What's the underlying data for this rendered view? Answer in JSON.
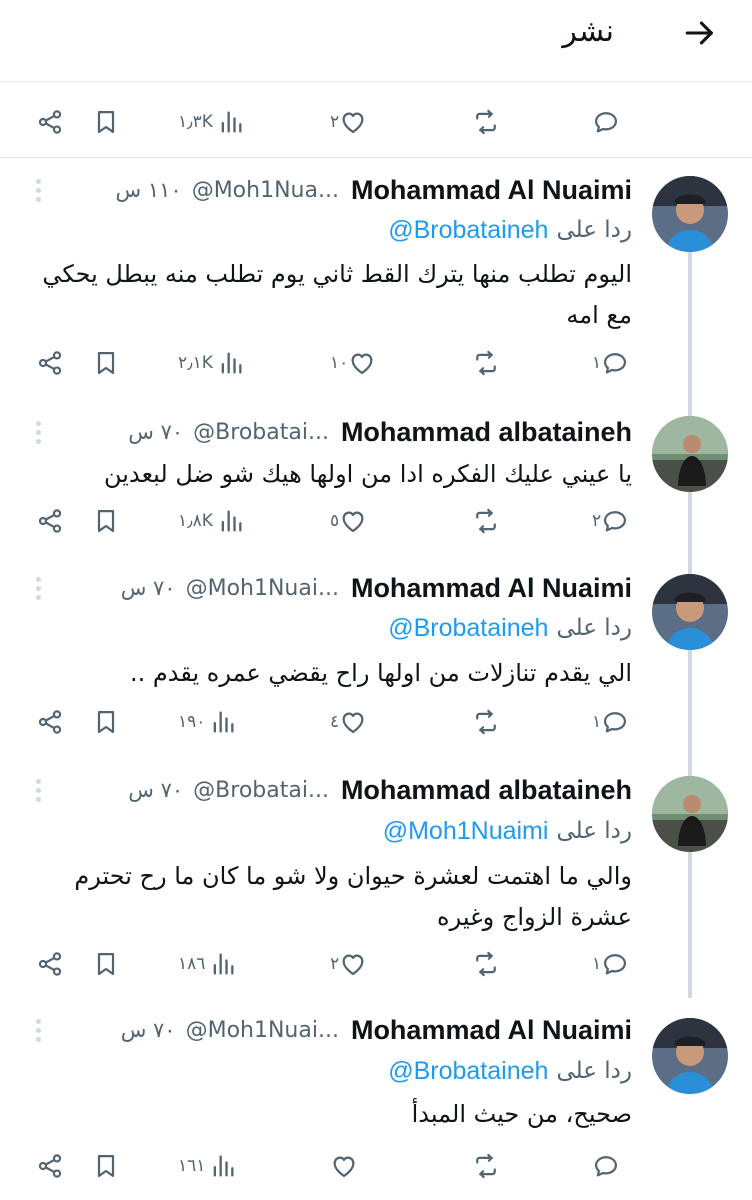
{
  "header": {
    "title": "نشر",
    "back_icon": "arrow-right-icon"
  },
  "top_actions": {
    "views": "١٫٣K",
    "likes": "٢",
    "retweets": "",
    "replies": ""
  },
  "tweets": [
    {
      "display_name": "Mohammad Al Nuaimi",
      "handle": "@Moh1Nua...",
      "time": "١١٠ س",
      "reply_label": "ردا على",
      "reply_target": "@Brobataineh",
      "text": "اليوم تطلب منها يترك القط ثاني يوم تطلب منه يبطل يحكي مع امه",
      "views": "٢٫١K",
      "likes": "١٠",
      "retweets": "",
      "replies": "١"
    },
    {
      "display_name": "Mohammad albataineh",
      "handle": "@Brobatai...",
      "time": "٧٠ س",
      "reply_label": "",
      "reply_target": "",
      "text": "يا عيني عليك الفكره ادا من اولها هيك شو ضل لبعدين",
      "views": "١٫٨K",
      "likes": "٥",
      "retweets": "",
      "replies": "٢"
    },
    {
      "display_name": "Mohammad Al Nuaimi",
      "handle": "@Moh1Nuai...",
      "time": "٧٠ س",
      "reply_label": "ردا على",
      "reply_target": "@Brobataineh",
      "text": "الي يقدم تنازلات من اولها راح يقضي عمره يقدم ..",
      "views": "١٩٠",
      "likes": "٤",
      "retweets": "",
      "replies": "١"
    },
    {
      "display_name": "Mohammad albataineh",
      "handle": "@Brobatai...",
      "time": "٧٠ س",
      "reply_label": "ردا على",
      "reply_target": "@Moh1Nuaimi",
      "text": "والي ما اهتمت لعشرة حيوان ولا شو ما كان ما رح تحترم عشرة الزواج وغيره",
      "views": "١٨٦",
      "likes": "٢",
      "retweets": "",
      "replies": "١"
    },
    {
      "display_name": "Mohammad Al Nuaimi",
      "handle": "@Moh1Nuai...",
      "time": "٧٠ س",
      "reply_label": "ردا على",
      "reply_target": "@Brobataineh",
      "text": "صحيح، من حيث المبدأ",
      "views": "١٦١",
      "likes": "",
      "retweets": "",
      "replies": ""
    }
  ],
  "colors": {
    "accent": "#1d9bf0",
    "muted": "#536471",
    "text": "#0f1419",
    "border": "#e6e9ec",
    "thread": "#cfd9de"
  }
}
